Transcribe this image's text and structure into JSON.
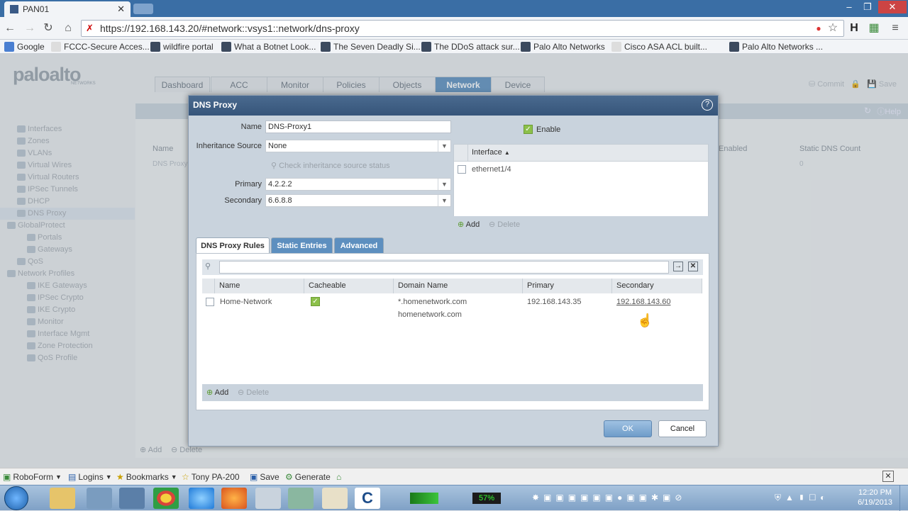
{
  "browser": {
    "tab_title": "PAN01",
    "url": "https://192.168.143.20/#network::vsys1::network/dns-proxy",
    "bookmarks": [
      "Google",
      "FCCC-Secure Acces...",
      "wildfire portal",
      "What a Botnet Look...",
      "The Seven Deadly Si...",
      "The DDoS attack sur...",
      "Palo Alto Networks",
      "Cisco ASA ACL built...",
      "Palo Alto Networks ..."
    ]
  },
  "app": {
    "logo": "paloalto",
    "logo_sub": "NETWORKS",
    "nav_tabs": [
      "Dashboard",
      "ACC",
      "Monitor",
      "Policies",
      "Objects",
      "Network",
      "Device"
    ],
    "active_tab": "Network",
    "top_actions": [
      "Commit",
      "Save"
    ],
    "help": "Help",
    "left_nav": [
      "Interfaces",
      "Zones",
      "VLANs",
      "Virtual Wires",
      "Virtual Routers",
      "IPSec Tunnels",
      "DHCP",
      "DNS Proxy",
      "GlobalProtect",
      "Portals",
      "Gateways",
      "QoS",
      "Network Profiles",
      "IKE Gateways",
      "IPSec Crypto",
      "IKE Crypto",
      "Monitor",
      "Interface Mgmt",
      "Zone Protection",
      "QoS Profile"
    ],
    "grid_headers": [
      "Name",
      "Enabled",
      "Static DNS Count"
    ],
    "grid_row": {
      "name": "DNS Proxy",
      "static_count": "0"
    },
    "grid_actions": [
      "Add",
      "Delete"
    ]
  },
  "dialog": {
    "title": "DNS Proxy",
    "name_label": "Name",
    "name_value": "DNS-Proxy1",
    "enable_label": "Enable",
    "inheritance_label": "Inheritance Source",
    "inheritance_value": "None",
    "check_inheritance": "Check inheritance source status",
    "primary_label": "Primary",
    "primary_value": "4.2.2.2",
    "secondary_label": "Secondary",
    "secondary_value": "6.6.8.8",
    "interface_header": "Interface",
    "interfaces": [
      "ethernet1/4"
    ],
    "add_label": "Add",
    "delete_label": "Delete",
    "subtabs": [
      "DNS Proxy Rules",
      "Static Entries",
      "Advanced"
    ],
    "rules_headers": [
      "Name",
      "Cacheable",
      "Domain Name",
      "Primary",
      "Secondary"
    ],
    "rules": [
      {
        "name": "Home-Network",
        "cacheable": true,
        "domains": [
          "*.homenetwork.com",
          "homenetwork.com"
        ],
        "primary": "192.168.143.35",
        "secondary": "192.168.143.60"
      }
    ],
    "ok_label": "OK",
    "cancel_label": "Cancel"
  },
  "taskbar": {
    "robo_items": [
      "RoboForm",
      "Logins",
      "Bookmarks",
      "Tony PA-200",
      "Save",
      "Generate"
    ],
    "battery": "57%",
    "time": "12:20 PM",
    "date": "6/19/2013"
  },
  "colors": {
    "accent": "#5d8fbf",
    "title_bar": "#3a6ea5",
    "check": "#8cc04a"
  }
}
